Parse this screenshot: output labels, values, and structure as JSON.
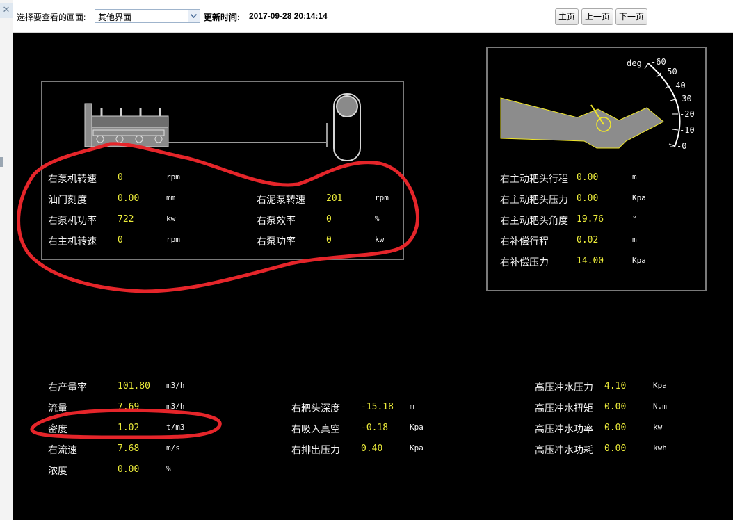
{
  "toolbar": {
    "select_label": "选择要查看的画面:",
    "select_value": "其他界面",
    "update_label": "更新时间:",
    "update_time": "2017-09-28 20:14:14",
    "buttons": [
      "主页",
      "上一页",
      "下一页"
    ]
  },
  "pump_panel": {
    "rows": [
      {
        "label": "右泵机转速",
        "value": "0",
        "unit": "rpm"
      },
      {
        "label": "油门刻度",
        "value": "0.00",
        "unit": "mm"
      },
      {
        "label": "右泵机功率",
        "value": "722",
        "unit": "kw"
      },
      {
        "label": "右主机转速",
        "value": "0",
        "unit": "rpm"
      },
      {
        "label": "右泥泵转速",
        "value": "201",
        "unit": "rpm"
      },
      {
        "label": "右泵效率",
        "value": "0",
        "unit": "%"
      },
      {
        "label": "右泵功率",
        "value": "0",
        "unit": "kw"
      }
    ]
  },
  "drag_panel": {
    "gauge_unit": "deg",
    "gauge_ticks": [
      "-60",
      "-50",
      "-40",
      "-30",
      "-20",
      "-10",
      "-0"
    ],
    "rows": [
      {
        "label": "右主动耙头行程",
        "value": "0.00",
        "unit": "m"
      },
      {
        "label": "右主动耙头压力",
        "value": "0.00",
        "unit": "Kpa"
      },
      {
        "label": "右主动耙头角度",
        "value": "19.76",
        "unit": "°"
      },
      {
        "label": "右补偿行程",
        "value": "0.02",
        "unit": "m"
      },
      {
        "label": "右补偿压力",
        "value": "14.00",
        "unit": "Kpa"
      }
    ]
  },
  "production": {
    "col1": [
      {
        "label": "右产量率",
        "value": "101.80",
        "unit": "m3/h"
      },
      {
        "label": "流量",
        "value": "7.69",
        "unit": "m3/h"
      },
      {
        "label": "密度",
        "value": "1.02",
        "unit": "t/m3"
      },
      {
        "label": "右流速",
        "value": "7.68",
        "unit": "m/s"
      },
      {
        "label": "浓度",
        "value": "0.00",
        "unit": "%"
      }
    ],
    "col2": [
      {
        "label": "右耙头深度",
        "value": "-15.18",
        "unit": "m"
      },
      {
        "label": "右吸入真空",
        "value": "-0.18",
        "unit": "Kpa"
      },
      {
        "label": "右排出压力",
        "value": "0.40",
        "unit": "Kpa"
      }
    ],
    "col3": [
      {
        "label": "高压冲水压力",
        "value": "4.10",
        "unit": "Kpa"
      },
      {
        "label": "高压冲水扭矩",
        "value": "0.00",
        "unit": "N.m"
      },
      {
        "label": "高压冲水功率",
        "value": "0.00",
        "unit": "kw"
      },
      {
        "label": "高压冲水功耗",
        "value": "0.00",
        "unit": "kwh"
      }
    ]
  },
  "colors": {
    "background": "#000000",
    "label": "#f4f4f4",
    "value": "#ecec3a",
    "panel_border": "#7a7a7a",
    "annotation": "#e5252a",
    "drag_arm": "#8c8c8c"
  }
}
